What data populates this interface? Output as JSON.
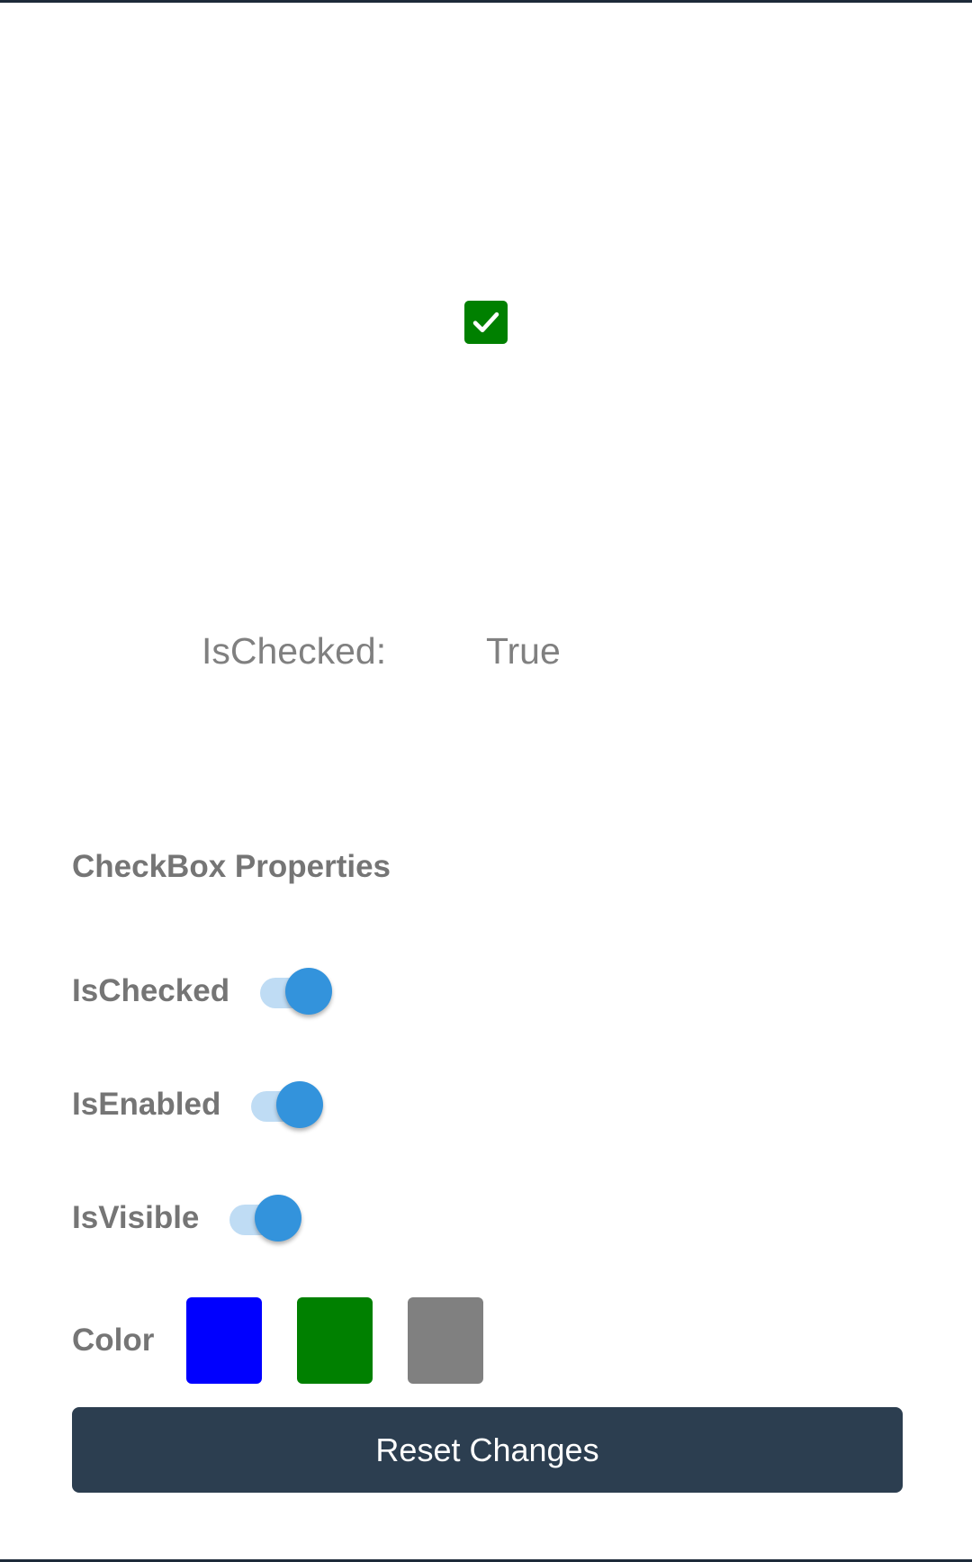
{
  "demo": {
    "checked": true,
    "checkbox_color": "#008000"
  },
  "readout": {
    "label": "IsChecked:",
    "value": "True"
  },
  "properties": {
    "title": "CheckBox Properties",
    "is_checked": {
      "label": "IsChecked",
      "on": true
    },
    "is_enabled": {
      "label": "IsEnabled",
      "on": true
    },
    "is_visible": {
      "label": "IsVisible",
      "on": true
    },
    "color": {
      "label": "Color",
      "options": [
        "#0000ff",
        "#008000",
        "#808080"
      ]
    }
  },
  "reset_button": {
    "label": "Reset Changes"
  },
  "colors": {
    "accent": "#3393dc",
    "track": "#bfdcf4",
    "button_bg": "#2c3e50",
    "label_text": "#757575"
  }
}
